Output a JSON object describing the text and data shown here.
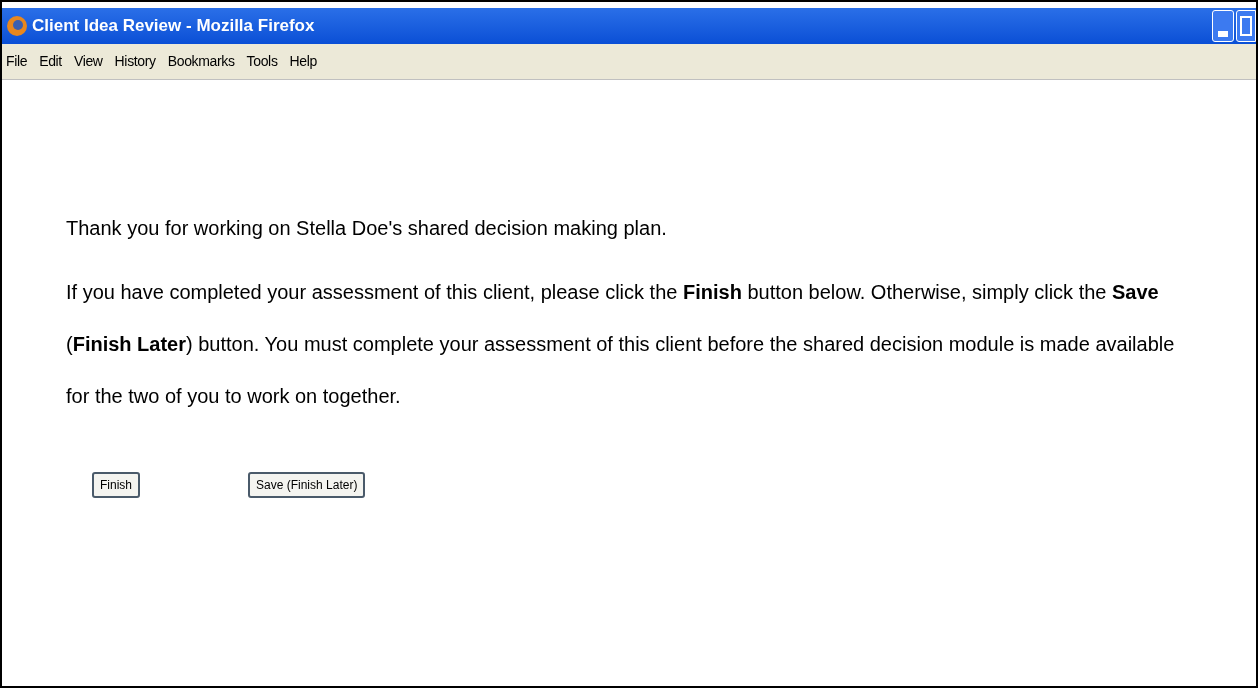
{
  "window": {
    "title": "Client Idea Review - Mozilla Firefox"
  },
  "menu": [
    "File",
    "Edit",
    "View",
    "History",
    "Bookmarks",
    "Tools",
    "Help"
  ],
  "paragraphs": [
    "Thank you for working on Stella Doe's shared decision making plan.",
    "If you have completed your assessment of this client, please click the **Finish** button below. Otherwise, simply click the **Save** (**Finish Later**) button. You must complete your assessment of this client before the shared decision module is made available for the two of you to work on together."
  ],
  "buttons": [
    "Finish",
    "Save (Finish Later)"
  ]
}
